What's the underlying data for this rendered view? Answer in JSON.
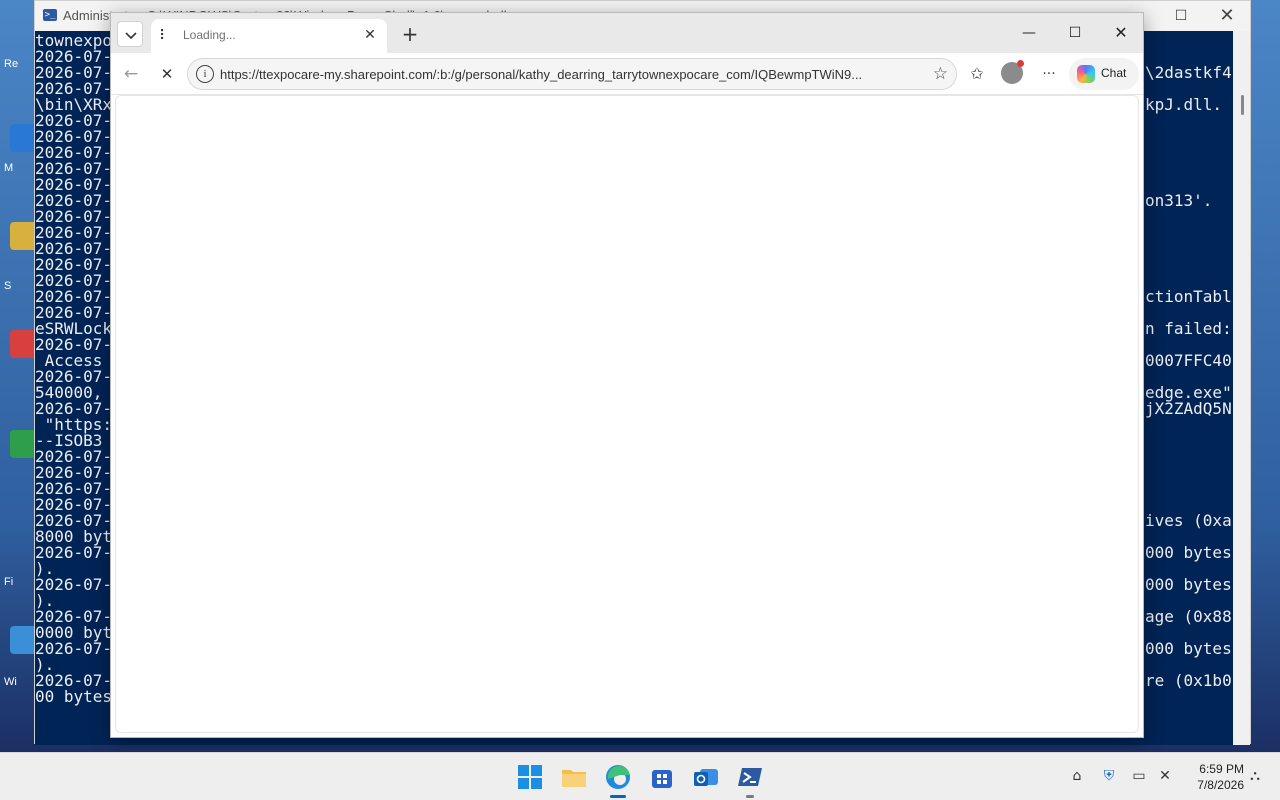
{
  "powershell": {
    "title": "Administrator: C:\\WINDOWS\\System32\\WindowsPowerShell\\v1.0\\powershell.exe",
    "left_lines": [
      "townexpo",
      "2026-07-",
      "2026-07-",
      "2026-07-",
      "\\bin\\XRx",
      "2026-07-",
      "2026-07-",
      "2026-07-",
      "2026-07-",
      "2026-07-",
      "2026-07-",
      "2026-07-",
      "2026-07-",
      "2026-07-",
      "2026-07-",
      "2026-07-",
      "2026-07-",
      "2026-07-",
      "eSRWLock",
      "2026-07-",
      " Access ",
      "2026-07-",
      "540000,",
      "2026-07-",
      " \"https:",
      "--ISOB3",
      "2026-07-",
      "2026-07-",
      "2026-07-",
      "2026-07-",
      "2026-07-",
      "8000 byt",
      "2026-07-",
      ").",
      "2026-07-",
      ").",
      "2026-07-",
      "0000 byt",
      "2026-07-",
      ").",
      "2026-07-",
      "00 bytes"
    ],
    "right_lines": [
      "\\2dastkf4",
      "kpJ.dll.",
      "on313'.",
      "ctionTabl",
      "n failed:",
      "0007FFC40",
      "edge.exe\"",
      "jX2ZAdQ5N",
      "ives (0xa",
      "000 bytes",
      "000 bytes",
      "age (0x88",
      "000 bytes",
      "re (0x1b0"
    ]
  },
  "browser": {
    "tab": {
      "title": "Loading...",
      "favicon": "⠇"
    },
    "address": {
      "url": "https://ttexpocare-my.sharepoint.com/:b:/g/personal/kathy_dearring_tarrytownexpocare_com/IQBewmpTWiN9..."
    },
    "chat_label": "Chat",
    "new_tab_glyph": "+",
    "back_glyph": "←",
    "stop_glyph": "✕",
    "more_glyph": "···"
  },
  "desktop": {
    "labels": [
      "Re",
      "M",
      "S",
      "Fi",
      "Wi"
    ]
  },
  "taskbar": {
    "time": "6:59 PM",
    "date": "7/8/2026"
  },
  "colors": {
    "console_bg": "#012456",
    "accent": "#0067c0"
  }
}
